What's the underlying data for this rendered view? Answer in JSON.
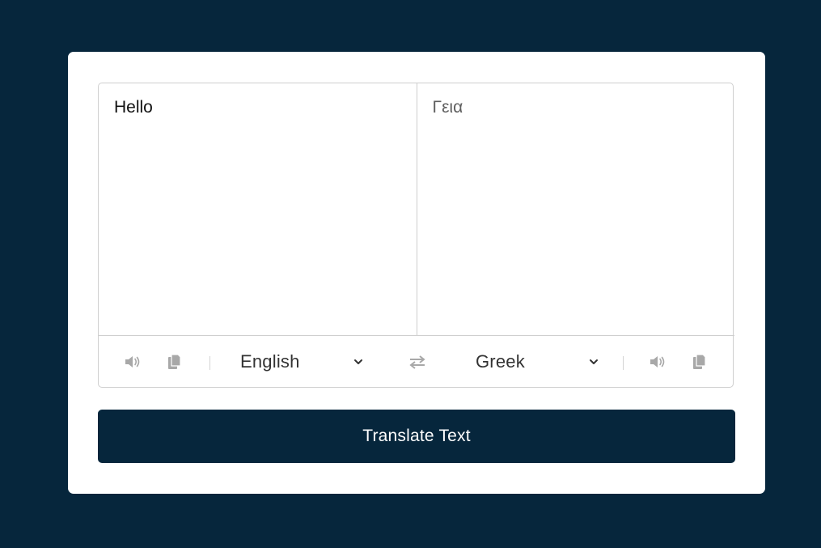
{
  "translator": {
    "from_text": "Hello",
    "to_text": "Γεια",
    "from_language": "English",
    "to_language": "Greek",
    "translate_button_label": "Translate Text"
  },
  "colors": {
    "page_background": "#06263c",
    "card_background": "#ffffff",
    "button_background": "#06263c",
    "icon_gray": "#a8a8a8"
  },
  "icons": {
    "from_speaker": "volume-icon",
    "from_copy": "copy-icon",
    "exchange": "exchange-arrows-icon",
    "to_speaker": "volume-icon",
    "to_copy": "copy-icon"
  }
}
